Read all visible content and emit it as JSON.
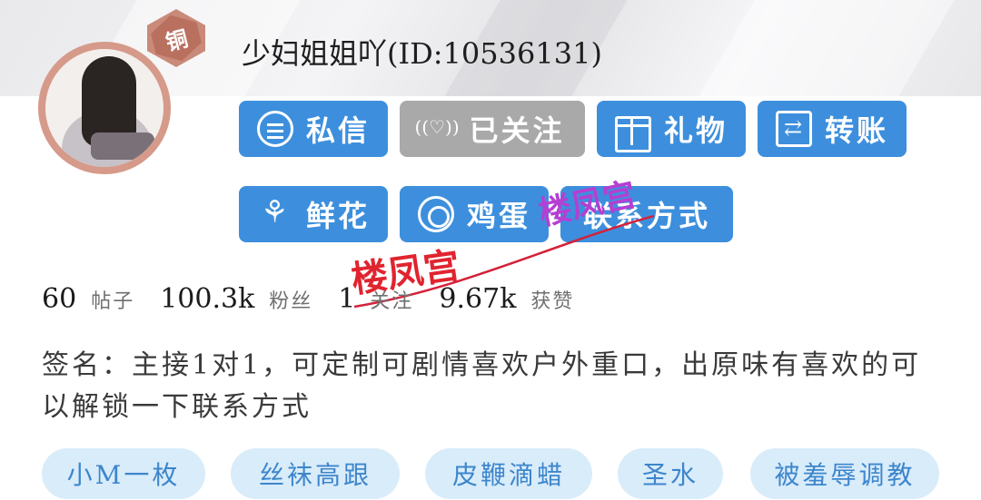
{
  "profile": {
    "username": "少妇姐姐吖(ID:10536131)",
    "medal": "铜"
  },
  "actions": {
    "message": "私信",
    "follow": "已关注",
    "gift": "礼物",
    "transfer": "转账",
    "flowers": "鲜花",
    "eggs": "鸡蛋",
    "contact": "联系方式"
  },
  "stats": {
    "posts_count": "60",
    "posts_label": "帖子",
    "fans_count": "100.3k",
    "fans_label": "粉丝",
    "following_count": "1",
    "following_label": "关注",
    "likes_count": "9.67k",
    "likes_label": "获赞"
  },
  "signature": "签名：主接1对1，可定制可剧情喜欢户外重口，出原味有喜欢的可以解锁一下联系方式",
  "tags": [
    "小M一枚",
    "丝袜高跟",
    "皮鞭滴蜡",
    "圣水",
    "被羞辱调教"
  ],
  "watermark": "楼凤宫",
  "colors": {
    "accent": "#3d8fdd",
    "followed": "#a9a9a9",
    "tag_bg": "#d9ecfa",
    "medal": "#b9705f"
  }
}
